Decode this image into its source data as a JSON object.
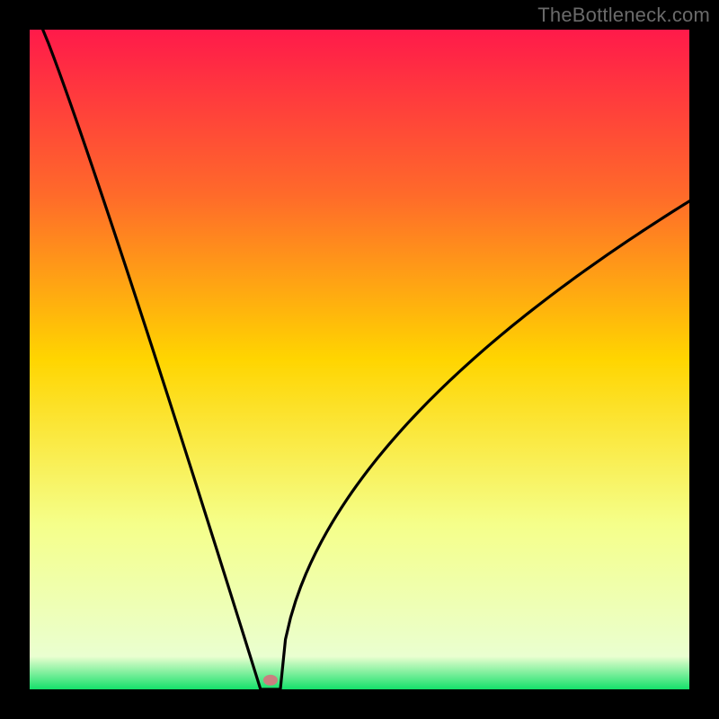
{
  "watermark": "TheBottleneck.com",
  "chart_data": {
    "type": "line",
    "title": "",
    "xlabel": "",
    "ylabel": "",
    "xlim": [
      0,
      100
    ],
    "ylim": [
      0,
      100
    ],
    "gradient_stops": [
      {
        "offset": 0,
        "color": "#ff1a4a"
      },
      {
        "offset": 25,
        "color": "#ff6a2a"
      },
      {
        "offset": 50,
        "color": "#ffd500"
      },
      {
        "offset": 75,
        "color": "#f5ff8a"
      },
      {
        "offset": 95,
        "color": "#eaffd0"
      },
      {
        "offset": 100,
        "color": "#14e06a"
      }
    ],
    "series": [
      {
        "name": "bottleneck-curve",
        "x_min": 2,
        "x_min_y": 100,
        "x_minimum": 35,
        "x_minimum_y": 0,
        "x_max": 100,
        "x_max_y": 74,
        "note": "V-shaped curve: sharp linear-ish descent from top-left to a minimum near x≈35, then convex rise flattening toward the right edge."
      }
    ],
    "marker": {
      "x": 36.5,
      "y": 1.4,
      "color": "#c98080",
      "rx": 8,
      "ry": 6
    }
  }
}
